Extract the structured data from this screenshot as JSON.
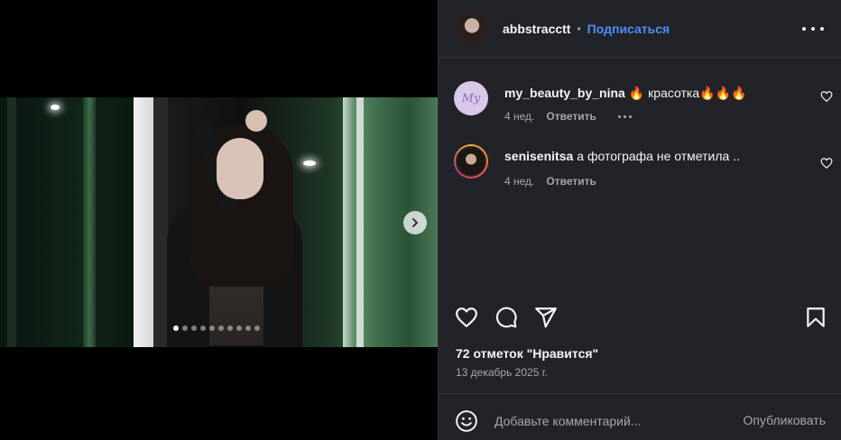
{
  "post": {
    "author": "abbstracctt",
    "separator": "•",
    "follow_label": "Подписаться",
    "carousel": {
      "total_slides": 10,
      "active_slide": 1
    }
  },
  "comments": [
    {
      "username": "my_beauty_by_nina",
      "text": "🔥 красотка🔥🔥🔥",
      "avatar_text": "My",
      "time": "4 нед.",
      "reply_label": "Ответить",
      "has_more": true
    },
    {
      "username": "senisenitsa",
      "text": "а фотографа не отметила ..",
      "time": "4 нед.",
      "reply_label": "Ответить",
      "has_more": false
    }
  ],
  "actions": {
    "like_icon": "heart-icon",
    "comment_icon": "comment-icon",
    "share_icon": "paper-plane-icon",
    "save_icon": "bookmark-icon"
  },
  "likes_text": "72 отметок \"Нравится\"",
  "date_text": "13 декабрь 2025 г.",
  "comment_box": {
    "placeholder": "Добавьте комментарий...",
    "publish_label": "Опубликовать"
  },
  "colors": {
    "panel_bg": "#212328",
    "accent": "#4c8ff7",
    "muted": "#a8a8a8",
    "text": "#f5f5f5"
  }
}
